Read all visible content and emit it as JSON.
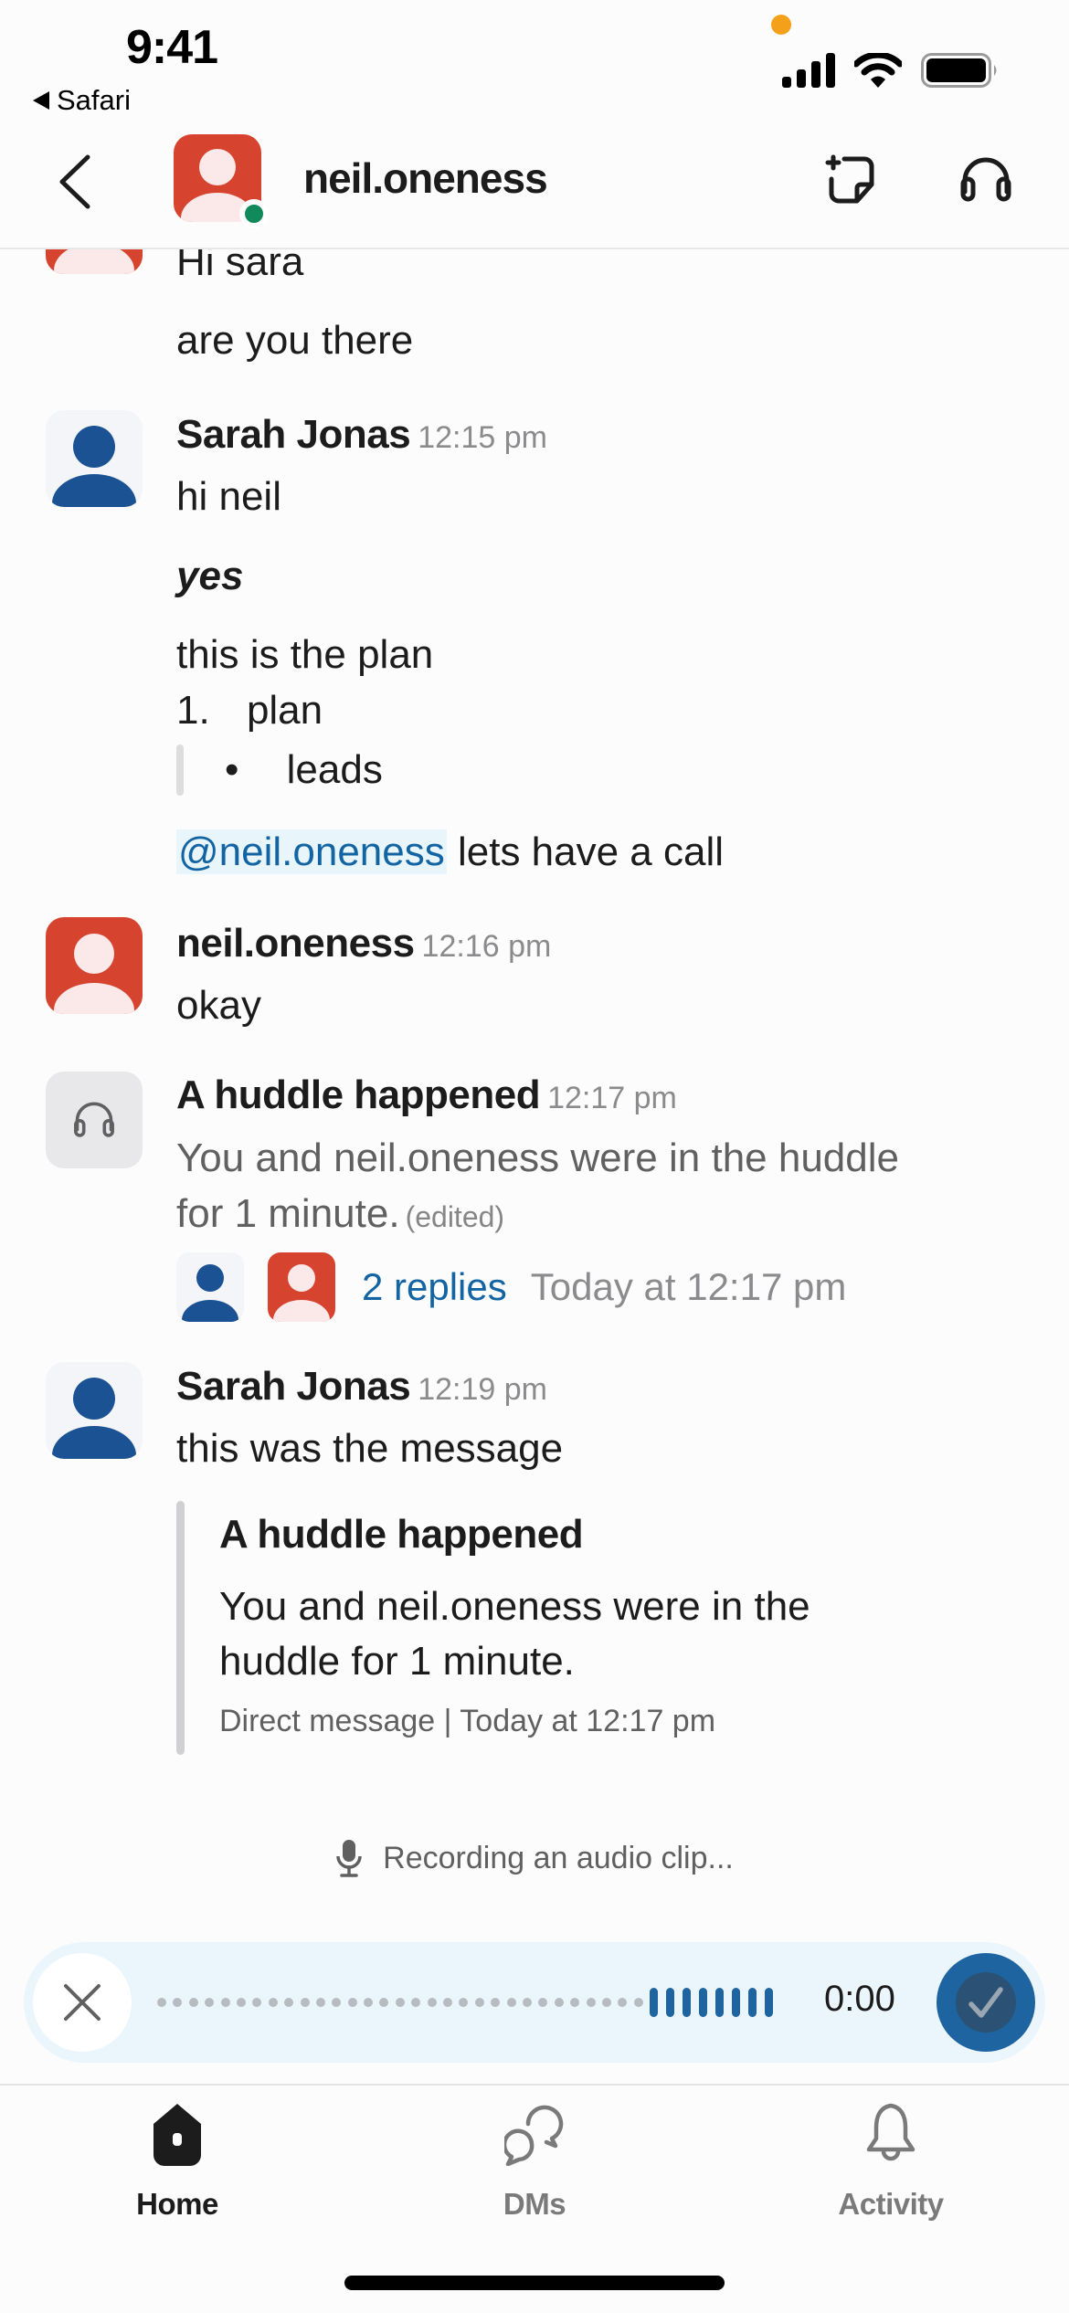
{
  "status_bar": {
    "time": "9:41",
    "back_app": "Safari"
  },
  "header": {
    "title": "neil.oneness",
    "presence": "active"
  },
  "messages": [
    {
      "id": "m0",
      "lines": [
        "Hi sara",
        "are you there"
      ]
    },
    {
      "id": "m1",
      "author": "Sarah Jonas",
      "time": "12:15 pm",
      "lines": {
        "l1": "hi neil",
        "l2": "yes",
        "l3": "this is the plan",
        "list_number": "1.",
        "list_item": "plan",
        "bullet": "•",
        "bullet_item": "leads",
        "mention": "@neil.oneness",
        "after_mention": " lets have a call"
      }
    },
    {
      "id": "m2",
      "author": "neil.oneness",
      "time": "12:16 pm",
      "text": "okay"
    },
    {
      "id": "m3",
      "author": "A huddle happened",
      "time": "12:17 pm",
      "line1": "You and neil.oneness were in the huddle",
      "line2": "for 1 minute.",
      "edited": "(edited)",
      "replies": "2 replies",
      "last_reply": "Today at 12:17 pm"
    },
    {
      "id": "m4",
      "author": "Sarah Jonas",
      "time": "12:19 pm",
      "text": "this was the message",
      "quote": {
        "title": "A huddle happened",
        "line1": "You and neil.oneness were in the",
        "line2": "huddle for 1 minute.",
        "meta": "Direct message | Today at 12:17 pm"
      }
    }
  ],
  "recording": {
    "status": "Recording an audio clip...",
    "elapsed": "0:00",
    "waveform_idle_dots": 31,
    "waveform_active_bars": 8
  },
  "tabs": [
    {
      "label": "Home",
      "icon": "home-icon",
      "active": true
    },
    {
      "label": "DMs",
      "icon": "dms-icon",
      "active": false
    },
    {
      "label": "Activity",
      "icon": "bell-icon",
      "active": false
    }
  ],
  "colors": {
    "accent_blue": "#1264a3",
    "recording_blue": "#1d64a0",
    "avatar_red": "#d64430",
    "presence_green": "#118a5b",
    "recording_dot": "#f5a01a"
  }
}
